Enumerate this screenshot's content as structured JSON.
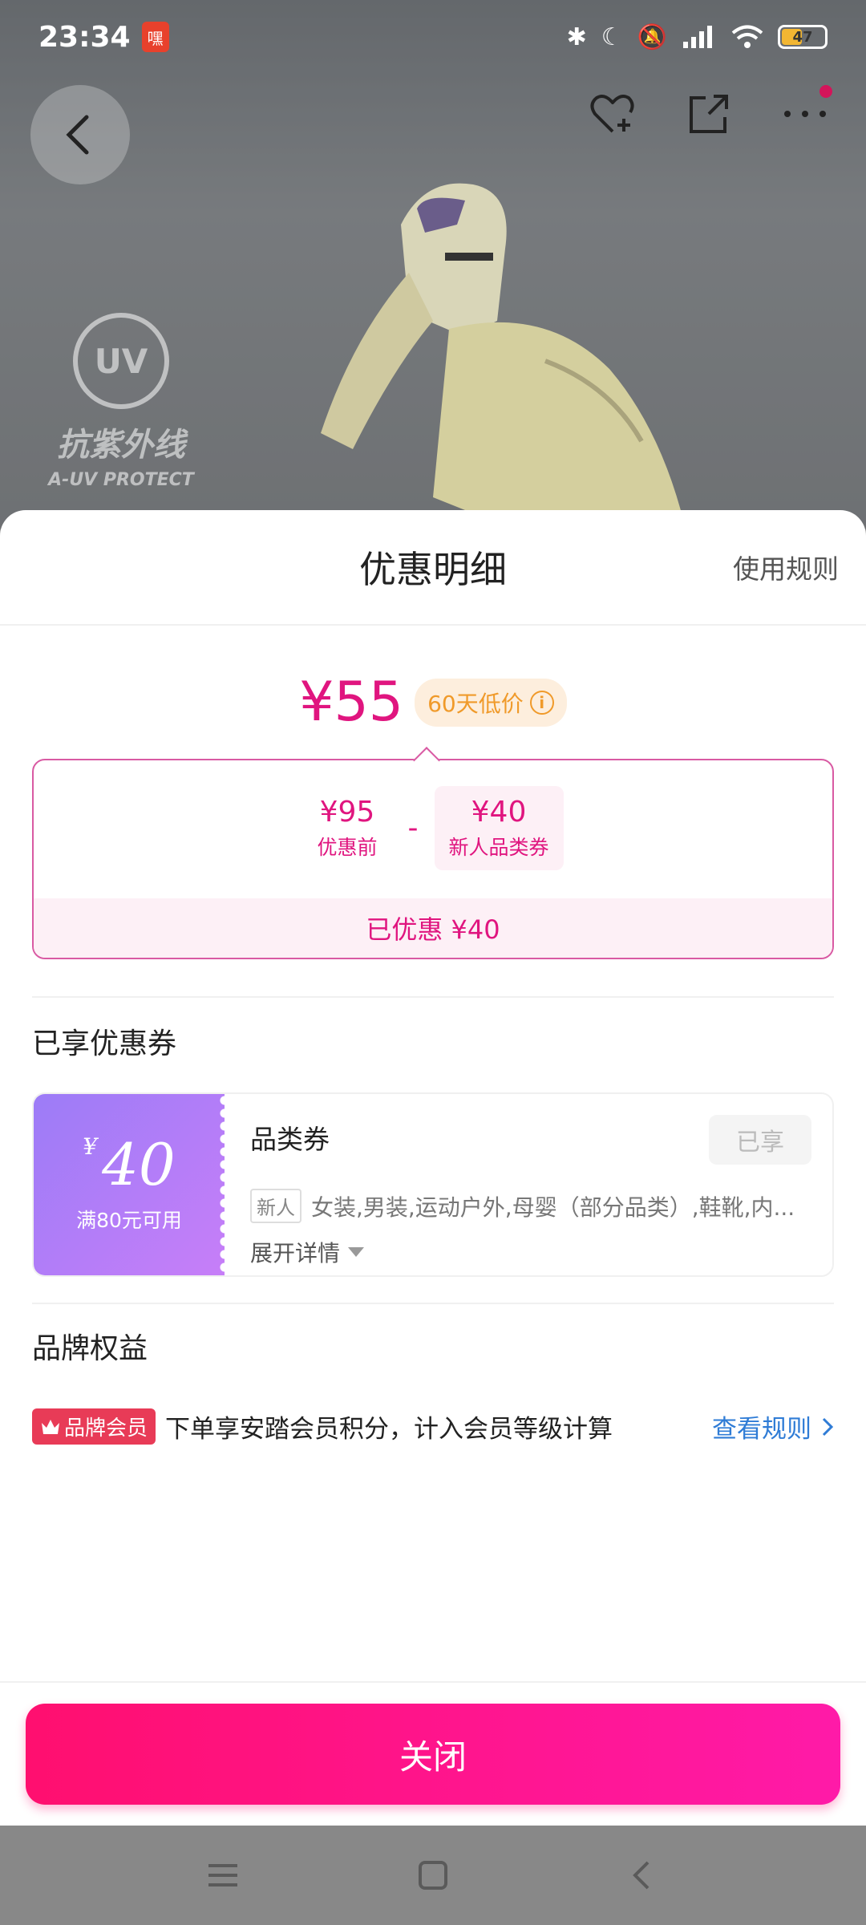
{
  "status_bar": {
    "time": "23:34",
    "app_icon_glyph": "嘿",
    "battery": "47"
  },
  "backdrop": {
    "uv_text": "抗紫外线",
    "uv_sub": "A-UV PROTECT",
    "uv_circle_text": "UV"
  },
  "sheet": {
    "title": "优惠明细",
    "rules_link": "使用规则",
    "final_price": "¥55",
    "low_price_tag": "60天低价",
    "breakdown": {
      "original": {
        "amount": "¥95",
        "label": "优惠前"
      },
      "operator": "-",
      "coupon": {
        "amount": "¥40",
        "label": "新人品类券"
      },
      "summary": "已优惠 ¥40"
    },
    "coupons_section": {
      "title": "已享优惠券",
      "coupon": {
        "currency": "¥",
        "amount": "40",
        "condition": "满80元可用",
        "name": "品类券",
        "status": "已享",
        "tag": "新人",
        "description": "女装,男装,运动户外,母婴（部分品类）,鞋靴,内...",
        "expand_label": "展开详情"
      }
    },
    "brand_section": {
      "title": "品牌权益",
      "badge": "品牌会员",
      "text": "下单享安踏会员积分，计入会员等级计算",
      "link": "查看规则"
    },
    "close_button": "关闭"
  },
  "colors": {
    "accent_pink": "#e0157f",
    "button_gradient_start": "#ff0f6f",
    "button_gradient_end": "#ff1aa8",
    "coupon_purple": "#9c7cf7",
    "link_blue": "#2f7cd6",
    "low_tag_orange": "#f09a2a"
  },
  "icons": {
    "nav": [
      "back-arrow-icon",
      "favorite-heart-icon",
      "share-icon",
      "more-icon"
    ],
    "system": [
      "menu-icon",
      "home-icon",
      "back-icon"
    ]
  }
}
